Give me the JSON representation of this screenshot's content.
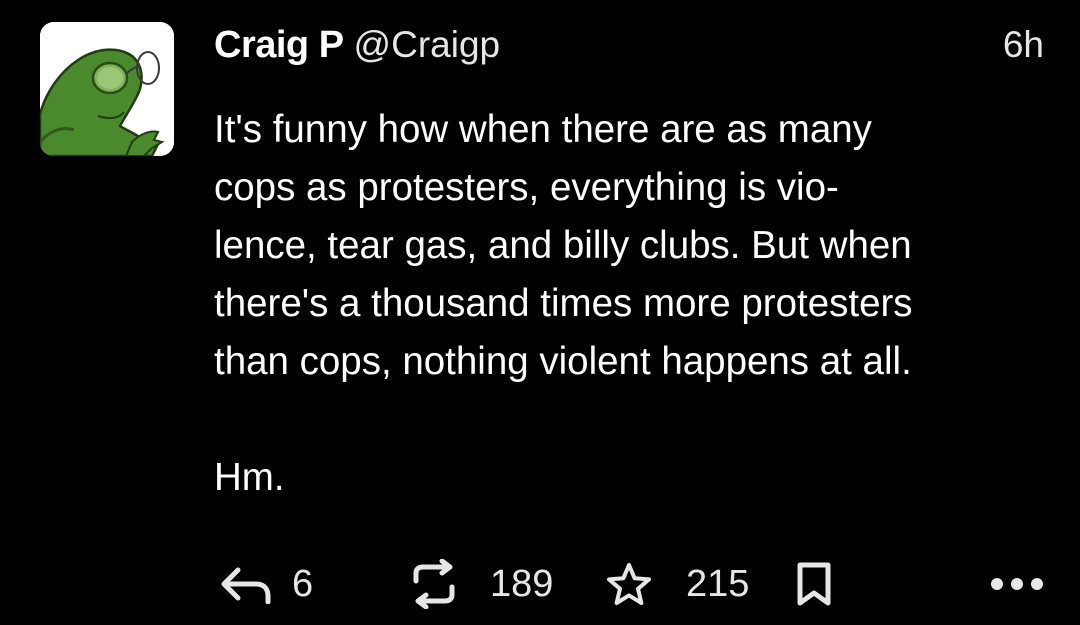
{
  "post": {
    "author": {
      "display_name": "Craig P",
      "handle": "@Craigp"
    },
    "timestamp": "6h",
    "body_lines": [
      "It's funny how when there are as many",
      "cops as protesters, everything is vio-",
      "lence, tear gas, and billy clubs. But when",
      "there's a thousand times more protesters",
      "than cops, nothing violent happens at all."
    ],
    "body_tail": "Hm.",
    "actions": {
      "reply": {
        "icon": "reply-icon",
        "count": "6"
      },
      "repost": {
        "icon": "repost-icon",
        "count": "189"
      },
      "favorite": {
        "icon": "star-icon",
        "count": "215"
      },
      "bookmark": {
        "icon": "bookmark-icon"
      },
      "more": {
        "icon": "more-dots-icon"
      }
    }
  },
  "colors": {
    "background": "#000000",
    "text": "#ffffff",
    "secondary_text": "#e6e6e6",
    "avatar_green": "#4a8a2c"
  }
}
